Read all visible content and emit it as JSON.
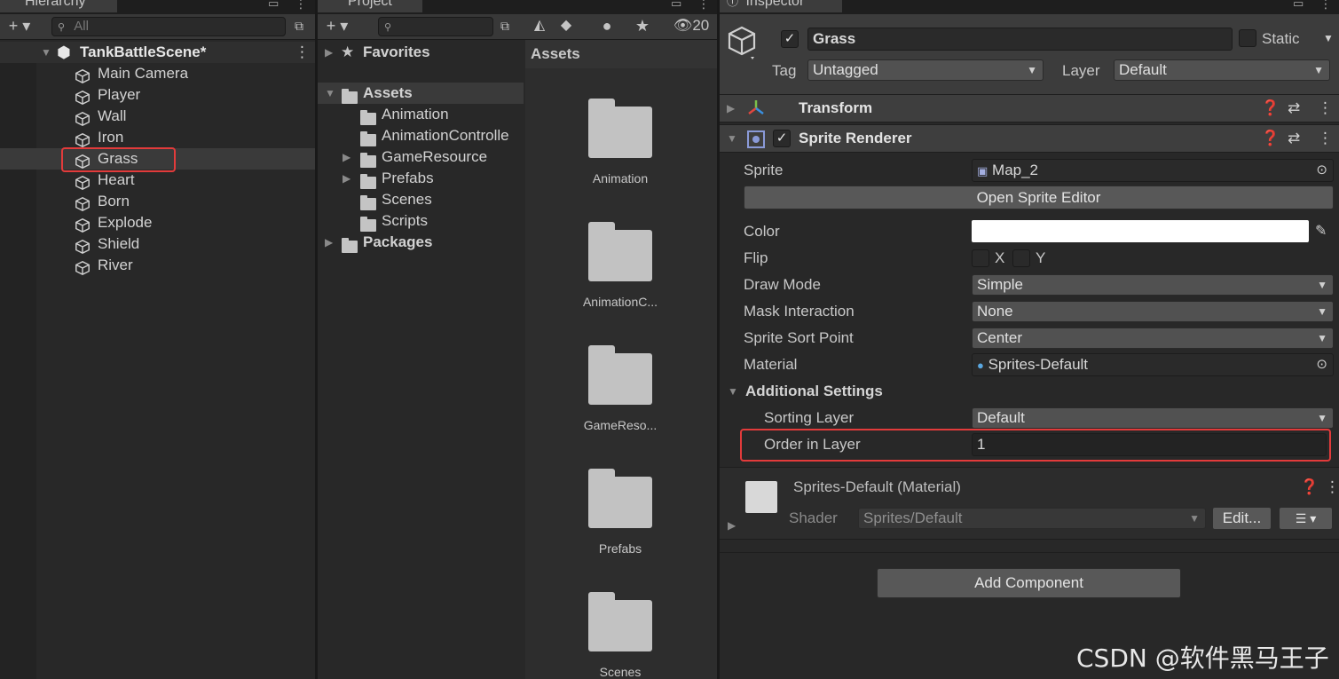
{
  "hierarchy": {
    "tab_label": "Hierarchy",
    "search_placeholder": "All",
    "scene_name": "TankBattleScene*",
    "items": [
      {
        "label": "Main Camera"
      },
      {
        "label": "Player"
      },
      {
        "label": "Wall"
      },
      {
        "label": "Iron"
      },
      {
        "label": "Grass",
        "selected": true
      },
      {
        "label": "Heart"
      },
      {
        "label": "Born"
      },
      {
        "label": "Explode"
      },
      {
        "label": "Shield"
      },
      {
        "label": "River"
      }
    ]
  },
  "project": {
    "tab_label": "Project",
    "hidden_count": "20",
    "tree": {
      "favorites": "Favorites",
      "assets": "Assets",
      "asset_folders": [
        "Animation",
        "AnimationControlle",
        "GameResource",
        "Prefabs",
        "Scenes",
        "Scripts"
      ],
      "packages": "Packages"
    },
    "grid_header": "Assets",
    "grid_items": [
      "Animation",
      "AnimationC...",
      "GameReso...",
      "Prefabs",
      "Scenes"
    ]
  },
  "inspector": {
    "tab_label": "Inspector",
    "object_name": "Grass",
    "static_label": "Static",
    "tag_label": "Tag",
    "tag_value": "Untagged",
    "layer_label": "Layer",
    "layer_value": "Default",
    "transform_title": "Transform",
    "sprite_renderer_title": "Sprite Renderer",
    "sprite_label": "Sprite",
    "sprite_value": "Map_2",
    "open_sprite_editor": "Open Sprite Editor",
    "color_label": "Color",
    "color_value": "#ffffff",
    "flip_label": "Flip",
    "flip_x": "X",
    "flip_y": "Y",
    "draw_mode_label": "Draw Mode",
    "draw_mode_value": "Simple",
    "mask_interaction_label": "Mask Interaction",
    "mask_interaction_value": "None",
    "sprite_sort_point_label": "Sprite Sort Point",
    "sprite_sort_point_value": "Center",
    "material_label": "Material",
    "material_value": "Sprites-Default",
    "additional_settings": "Additional Settings",
    "sorting_layer_label": "Sorting Layer",
    "sorting_layer_value": "Default",
    "order_in_layer_label": "Order in Layer",
    "order_in_layer_value": "1",
    "material_section_title": "Sprites-Default (Material)",
    "shader_label": "Shader",
    "shader_value": "Sprites/Default",
    "edit_button": "Edit...",
    "add_component": "Add Component"
  },
  "watermark": "CSDN @软件黑马王子",
  "colors": {
    "highlight": "#e23b3b",
    "panel_bg": "#282828",
    "header_bg": "#3e3e3e"
  }
}
